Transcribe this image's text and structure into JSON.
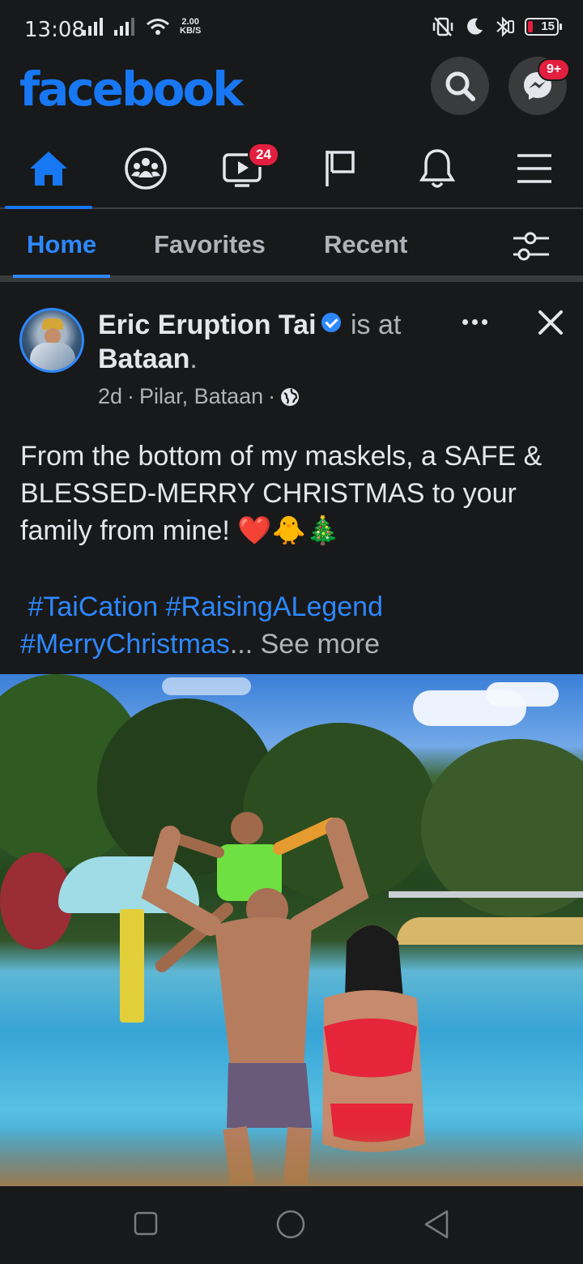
{
  "status_bar": {
    "time": "13:08",
    "net_speed_value": "2.00",
    "net_speed_unit": "KB/S",
    "battery": "15"
  },
  "header": {
    "logo": "facebook",
    "messenger_badge": "9+"
  },
  "nav": {
    "items": [
      {
        "name": "home",
        "icon": "home-icon",
        "active": true
      },
      {
        "name": "groups",
        "icon": "groups-icon"
      },
      {
        "name": "watch",
        "icon": "video-icon",
        "badge": "24"
      },
      {
        "name": "pages",
        "icon": "flag-icon"
      },
      {
        "name": "notifications",
        "icon": "bell-icon"
      },
      {
        "name": "menu",
        "icon": "hamburger-icon"
      }
    ]
  },
  "feed_filters": {
    "home": "Home",
    "favorites": "Favorites",
    "recent": "Recent"
  },
  "post": {
    "author": "Eric Eruption Tai",
    "is_at": "is at",
    "place": "Bataan",
    "time_ago": "2d",
    "location": "Pilar, Bataan",
    "dot": "·",
    "text": "From the bottom of my maskels, a SAFE & BLESSED-MERRY CHRISTMAS to your family from mine! ❤️🐥🎄",
    "tags": [
      "#TaiCation",
      "#RaisingALegend",
      "#MerryChristmas"
    ],
    "ellipsis": "...",
    "see_more": "See more"
  },
  "colors": {
    "background": "#18191a",
    "accent": "#1877f2",
    "link": "#2d88ff",
    "badge": "#e41e3f"
  }
}
